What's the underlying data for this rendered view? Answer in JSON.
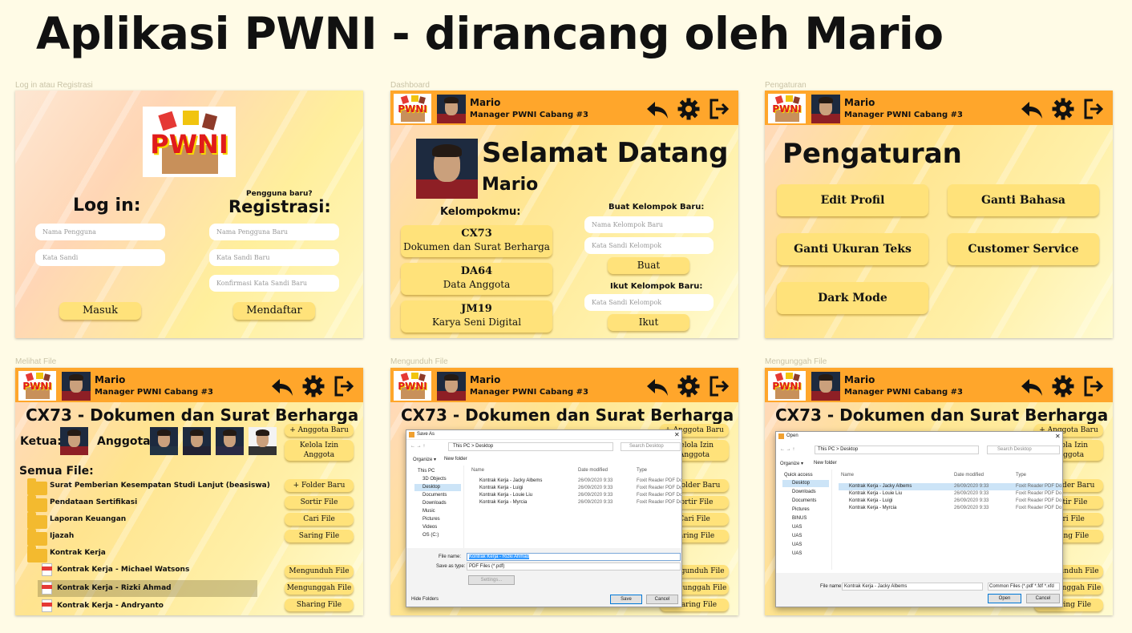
{
  "main_title": "Aplikasi PWNI - dirancang oleh Mario",
  "logo_text": "PWNI",
  "frames": {
    "login": {
      "label": "Log in atau Registrasi",
      "login_title": "Log in:",
      "new_user": "Pengguna baru?",
      "register_title": "Registrasi:",
      "username_placeholder": "Nama Pengguna",
      "password_placeholder": "Kata Sandi",
      "new_username_placeholder": "Nama Pengguna Baru",
      "new_password_placeholder": "Kata Sandi Baru",
      "confirm_password_placeholder": "Konfirmasi Kata Sandi Baru",
      "login_button": "Masuk",
      "register_button": "Mendaftar"
    },
    "dashboard": {
      "label": "Dashboard",
      "welcome": "Selamat Datang",
      "name": "Mario",
      "groups_title": "Kelompokmu:",
      "groups": [
        {
          "code": "CX73",
          "name": "Dokumen dan Surat Berharga"
        },
        {
          "code": "DA64",
          "name": "Data Anggota"
        },
        {
          "code": "JM19",
          "name": "Karya Seni Digital"
        }
      ],
      "create_title": "Buat Kelompok Baru:",
      "group_name_placeholder": "Nama Kelompok Baru",
      "group_password_placeholder": "Kata Sandi Kelompok",
      "create_button": "Buat",
      "join_title": "Ikut Kelompok Baru:",
      "join_password_placeholder": "Kata Sandi Kelompok",
      "join_button": "Ikut"
    },
    "settings": {
      "label": "Pengaturan",
      "title": "Pengaturan",
      "buttons": [
        "Edit Profil",
        "Ganti Bahasa",
        "Ganti Ukuran Teks",
        "Customer Service",
        "Dark Mode"
      ]
    },
    "view": {
      "label": "Melihat File"
    },
    "download": {
      "label": "Mengunduh File"
    },
    "upload": {
      "label": "Mengunggah File"
    }
  },
  "header": {
    "user_name": "Mario",
    "user_role": "Manager PWNI Cabang #3",
    "icons": [
      "back-arrow-icon",
      "gear-icon",
      "logout-icon"
    ]
  },
  "group_page": {
    "title": "CX73 - Dokumen dan Surat Berharga",
    "leader_label": "Ketua:",
    "members_label": "Anggota:",
    "add_member": "+ Anggota Baru",
    "manage_perm": "Kelola Izin Anggota",
    "all_files": "Semua File:",
    "folders": [
      "Surat Pemberian Kesempatan Studi Lanjut (beasiswa)",
      "Pendataan Sertifikasi",
      "Laporan Keuangan",
      "Ijazah",
      "Kontrak Kerja"
    ],
    "files": [
      "Kontrak Kerja - Michael Watsons",
      "Kontrak Kerja - Rizki Ahmad",
      "Kontrak Kerja - Andryanto"
    ],
    "actions": [
      "+ Folder Baru",
      "Sortir File",
      "Cari File",
      "Saring File",
      "Mengunduh File",
      "Mengunggah File",
      "Sharing File"
    ]
  },
  "save_dialog": {
    "title": "Save As",
    "path": "This PC  >  Desktop",
    "search": "Search Desktop",
    "organize": "Organize ▾",
    "new_folder": "New folder",
    "nav": [
      "This PC",
      "3D Objects",
      "Desktop",
      "Documents",
      "Downloads",
      "Music",
      "Pictures",
      "Videos",
      "OS (C:)"
    ],
    "columns": [
      "Name",
      "Date modified",
      "Type"
    ],
    "files": [
      {
        "name": "Kontrak Kerja - Jacky Albems",
        "date": "26/09/2020 9:33",
        "type": "Foxit Reader PDF Do..."
      },
      {
        "name": "Kontrak Kerja - Luigi",
        "date": "26/09/2020 9:33",
        "type": "Foxit Reader PDF Do..."
      },
      {
        "name": "Kontrak Kerja - Louie Liu",
        "date": "26/09/2020 9:33",
        "type": "Foxit Reader PDF Do..."
      },
      {
        "name": "Kontrak Kerja - Myrcia",
        "date": "26/09/2020 9:33",
        "type": "Foxit Reader PDF Do..."
      }
    ],
    "file_name_label": "File name:",
    "file_name": "Kontrak Kerja - Rizki Ahmad",
    "save_type_label": "Save as type:",
    "save_type": "PDF Files (*.pdf)",
    "settings": "Settings...",
    "hide_folders": "Hide Folders",
    "save": "Save",
    "cancel": "Cancel"
  },
  "open_dialog": {
    "title": "Open",
    "path": "This PC  >  Desktop",
    "search": "Search Desktop",
    "organize": "Organize ▾",
    "new_folder": "New folder",
    "nav": [
      "Quick access",
      "Desktop",
      "Downloads",
      "Documents",
      "Pictures",
      "BINUS",
      "UAS",
      "UAS",
      "UAS",
      "UAS"
    ],
    "columns": [
      "Name",
      "Date modified",
      "Type"
    ],
    "files": [
      {
        "name": "Kontrak Kerja - Jacky Albems",
        "date": "26/09/2020 9:33",
        "type": "Foxit Reader PDF Do..."
      },
      {
        "name": "Kontrak Kerja - Louie Liu",
        "date": "26/09/2020 9:33",
        "type": "Foxit Reader PDF Do..."
      },
      {
        "name": "Kontrak Kerja - Luigi",
        "date": "26/09/2020 9:33",
        "type": "Foxit Reader PDF Do..."
      },
      {
        "name": "Kontrak Kerja - Myrcia",
        "date": "26/09/2020 9:33",
        "type": "Foxit Reader PDF Do..."
      }
    ],
    "file_name_label": "File name:",
    "file_name": "Kontrak Kerja - Jacky Albems",
    "file_type": "Common Files (*.pdf *.fdf *.xfd",
    "open": "Open",
    "cancel": "Cancel"
  },
  "colors": {
    "header": "#ffa62b",
    "button": "#ffe27a",
    "background": "#fffbe6"
  }
}
